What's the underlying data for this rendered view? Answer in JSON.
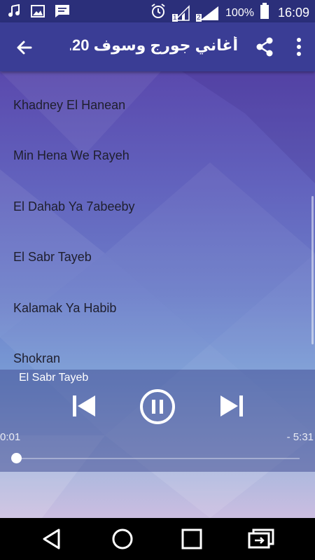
{
  "status_bar": {
    "sim1_label": "1",
    "sim2_label": "2",
    "battery": "100%",
    "time": "16:09",
    "icons": [
      "music-icon",
      "image-icon",
      "message-icon",
      "alarm-icon",
      "signal-icon",
      "battery-icon"
    ]
  },
  "app_bar": {
    "title": "أغاني جورج وسوف 20...",
    "icons": [
      "back-arrow-icon",
      "share-icon",
      "more-vert-icon"
    ]
  },
  "songs": [
    {
      "title": "Khadney El Hanean"
    },
    {
      "title": "Min Hena We Rayeh"
    },
    {
      "title": "El Dahab Ya 7abeeby"
    },
    {
      "title": "El Sabr Tayeb"
    },
    {
      "title": "Kalamak Ya Habib"
    },
    {
      "title": "Shokran"
    }
  ],
  "player": {
    "now_playing": "El Sabr Tayeb",
    "elapsed": "0:01",
    "remaining": "- 5:31",
    "progress": 0.003,
    "state": "playing",
    "icons": [
      "skip-previous-icon",
      "pause-icon",
      "skip-next-icon"
    ]
  },
  "colors": {
    "app_bar": "#3a3d95",
    "status_bar": "#2b2f7a",
    "gradient_top": "#5a49ad",
    "gradient_bottom": "#cbbde0"
  }
}
